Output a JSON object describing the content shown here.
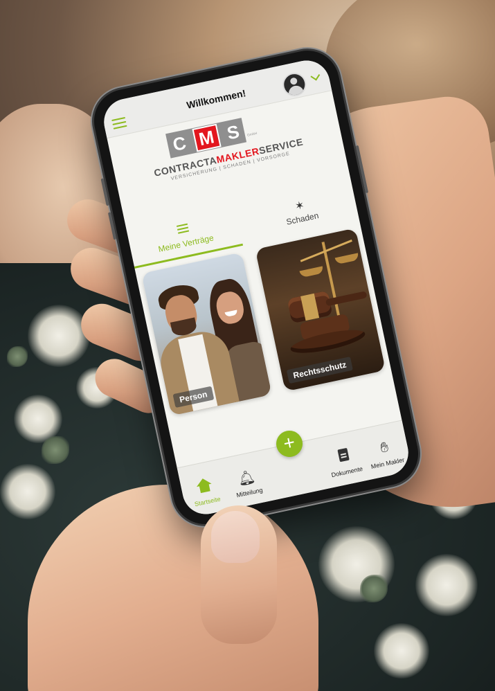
{
  "header": {
    "title": "Willkommen!"
  },
  "logo": {
    "letters": [
      "C",
      "M",
      "S"
    ],
    "small": "GmbH",
    "word_left": "CONTRACTA",
    "word_mid": "MAKLER",
    "word_right": "SERVICE",
    "tagline": "VERSICHERUNG | SCHADEN | VORSORGE"
  },
  "tabs": [
    {
      "label": "Meine Verträge",
      "active": true,
      "icon": "list-icon"
    },
    {
      "label": "Schaden",
      "active": false,
      "icon": "damage-icon"
    }
  ],
  "cards": [
    {
      "label": "Person"
    },
    {
      "label": "Rechtsschutz"
    }
  ],
  "bottom_nav": {
    "add_label": "+",
    "items": [
      {
        "label": "Startseite",
        "icon": "home-icon",
        "active": true
      },
      {
        "label": "Mitteilung",
        "icon": "bell-icon",
        "active": false
      },
      {
        "label": "Dokumente",
        "icon": "document-icon",
        "active": false
      },
      {
        "label": "Mein Makler",
        "icon": "handshake-icon",
        "active": false
      }
    ]
  },
  "colors": {
    "accent": "#8dbb1f",
    "brand_red": "#e3161e",
    "logo_gray": "#8f8f8f"
  }
}
